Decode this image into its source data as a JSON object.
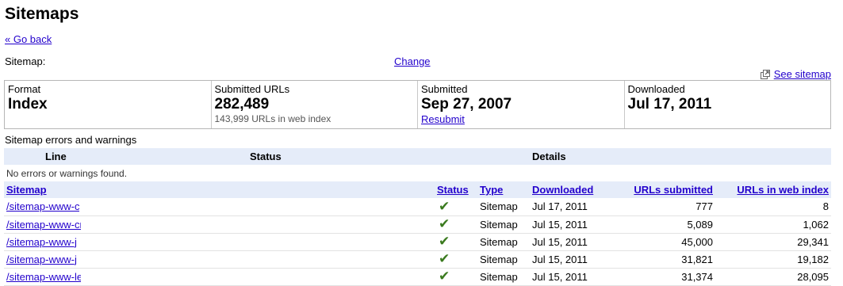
{
  "header": {
    "title": "Sitemaps",
    "go_back": "« Go back",
    "sitemap_label": "Sitemap:",
    "change_link": "Change",
    "see_sitemap": "See sitemap"
  },
  "summary": {
    "format_label": "Format",
    "format_value": "Index",
    "submitted_urls_label": "Submitted URLs",
    "submitted_urls_value": "282,489",
    "submitted_urls_sub": "143,999 URLs in web index",
    "submitted_label": "Submitted",
    "submitted_value": "Sep 27, 2007",
    "resubmit_link": "Resubmit",
    "downloaded_label": "Downloaded",
    "downloaded_value": "Jul 17, 2011"
  },
  "errors": {
    "title": "Sitemap errors and warnings",
    "headers": [
      "Line",
      "Status",
      "Details"
    ],
    "empty_message": "No errors or warnings found."
  },
  "sitemaps": {
    "headers": [
      "Sitemap",
      "Status",
      "Type",
      "Downloaded",
      "URLs submitted",
      "URLs in web index"
    ],
    "rows": [
      {
        "sitemap": "/sitemap-www-c",
        "status_icon": "checkmark-icon",
        "type": "Sitemap",
        "downloaded": "Jul 17, 2011",
        "urls_submitted": "777",
        "urls_indexed": "8"
      },
      {
        "sitemap": "/sitemap-www-cr",
        "status_icon": "checkmark-icon",
        "type": "Sitemap",
        "downloaded": "Jul 15, 2011",
        "urls_submitted": "5,089",
        "urls_indexed": "1,062"
      },
      {
        "sitemap": "/sitemap-www-j",
        "status_icon": "checkmark-icon",
        "type": "Sitemap",
        "downloaded": "Jul 15, 2011",
        "urls_submitted": "45,000",
        "urls_indexed": "29,341"
      },
      {
        "sitemap": "/sitemap-www-j",
        "status_icon": "checkmark-icon",
        "type": "Sitemap",
        "downloaded": "Jul 15, 2011",
        "urls_submitted": "31,821",
        "urls_indexed": "19,182"
      },
      {
        "sitemap": "/sitemap-www-le",
        "status_icon": "checkmark-icon",
        "type": "Sitemap",
        "downloaded": "Jul 15, 2011",
        "urls_submitted": "31,374",
        "urls_indexed": "28,095"
      }
    ]
  }
}
